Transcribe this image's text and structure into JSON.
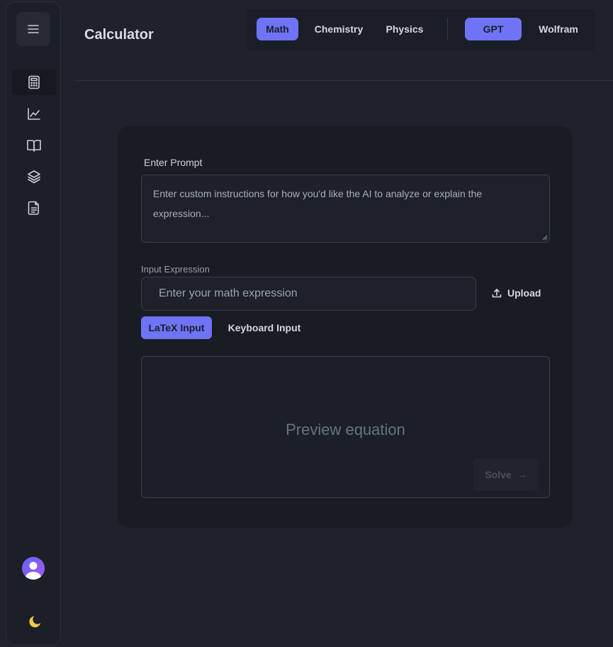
{
  "app": {
    "title": "Calculator"
  },
  "sidebar": {
    "menu_icon": "hamburger-icon",
    "items": [
      {
        "name": "calculator",
        "icon": "calculator-icon",
        "active": true
      },
      {
        "name": "graph",
        "icon": "chart-line-icon",
        "active": false
      },
      {
        "name": "library",
        "icon": "book-open-icon",
        "active": false
      },
      {
        "name": "layers",
        "icon": "layers-icon",
        "active": false
      },
      {
        "name": "documents",
        "icon": "document-icon",
        "active": false
      }
    ],
    "avatar_icon": "user-avatar-icon",
    "theme_icon": "moon-icon"
  },
  "topbar": {
    "subjects": [
      {
        "label": "Math",
        "active": true
      },
      {
        "label": "Chemistry",
        "active": false
      },
      {
        "label": "Physics",
        "active": false
      }
    ],
    "engines": [
      {
        "label": "GPT",
        "active": true
      },
      {
        "label": "Wolfram",
        "active": false
      }
    ]
  },
  "form": {
    "prompt_label": "Enter Prompt",
    "prompt_placeholder": "Enter custom instructions for how you'd like the AI to analyze or explain the expression...",
    "expression_label": "Input Expression",
    "expression_placeholder": "Enter your math expression",
    "upload_label": "Upload",
    "input_modes": [
      {
        "label": "LaTeX Input",
        "active": true
      },
      {
        "label": "Keyboard Input",
        "active": false
      }
    ],
    "preview_placeholder": "Preview equation",
    "solve_label": "Solve",
    "solve_arrow": "→"
  },
  "colors": {
    "accent": "#6e74f5",
    "background": "#1d222b",
    "card": "#181c23"
  }
}
